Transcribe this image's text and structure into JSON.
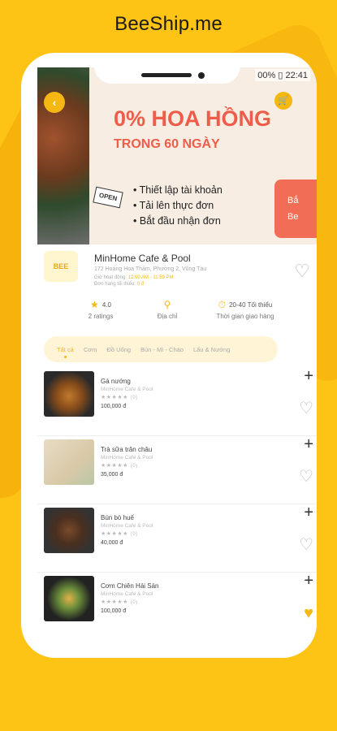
{
  "brand": "BeeShip.me",
  "status": {
    "battery": "00%",
    "time": "22:41"
  },
  "banner": {
    "title": "0% HOA HỒNG",
    "subtitle": "TRONG 60 NGÀY",
    "bullets": [
      "Thiết lập tài khoản",
      "Tải lên thực đơn",
      "Bắt đầu nhận đơn"
    ],
    "side_button_line1": "Bắ",
    "side_button_line2": "Be",
    "open_sign": "OPEN"
  },
  "shop": {
    "logo_text": "BEE",
    "name": "MinHome Cafe & Pool",
    "address": "172 Hoàng Hoa Thám, Phường 2, Vũng Tàu",
    "hours_label": "Giờ hoạt động:",
    "hours_value": "12:00 AM - 11:59 PM",
    "min_label": "Đơn hàng tối thiểu:",
    "min_value": "0 đ"
  },
  "stats": {
    "rating": "4.0",
    "ratings_label": "2 ratings",
    "address_label": "Địa chỉ",
    "delivery_value": "20-40 Tối thiểu",
    "delivery_label": "Thời gian giao hàng"
  },
  "tabs": [
    "Tất cả",
    "Cơm",
    "Đồ Uống",
    "Bún - Mì - Cháo",
    "Lẩu & Nướng"
  ],
  "items": [
    {
      "name": "Gà nướng",
      "shop": "MinHome Cafe & Pool",
      "stars": "★★★★★",
      "count": "(0)",
      "price": "100,000 đ",
      "favorite": false
    },
    {
      "name": "Trà sữa trân châu",
      "shop": "MinHome Cafe & Pool",
      "stars": "★★★★★",
      "count": "(0)",
      "price": "35,000 đ",
      "favorite": false
    },
    {
      "name": "Bún bò huế",
      "shop": "MinHome Cafe & Pool",
      "stars": "★★★★★",
      "count": "(0)",
      "price": "40,000 đ",
      "favorite": false
    },
    {
      "name": "Cơm Chiên Hải Sản",
      "shop": "MinHome Cafe & Pool",
      "stars": "★★★★★",
      "count": "(0)",
      "price": "100,000 đ",
      "favorite": true
    }
  ],
  "colors": {
    "background": "#FDC315",
    "accent": "#F5B812",
    "promo": "#EE5D4A"
  }
}
